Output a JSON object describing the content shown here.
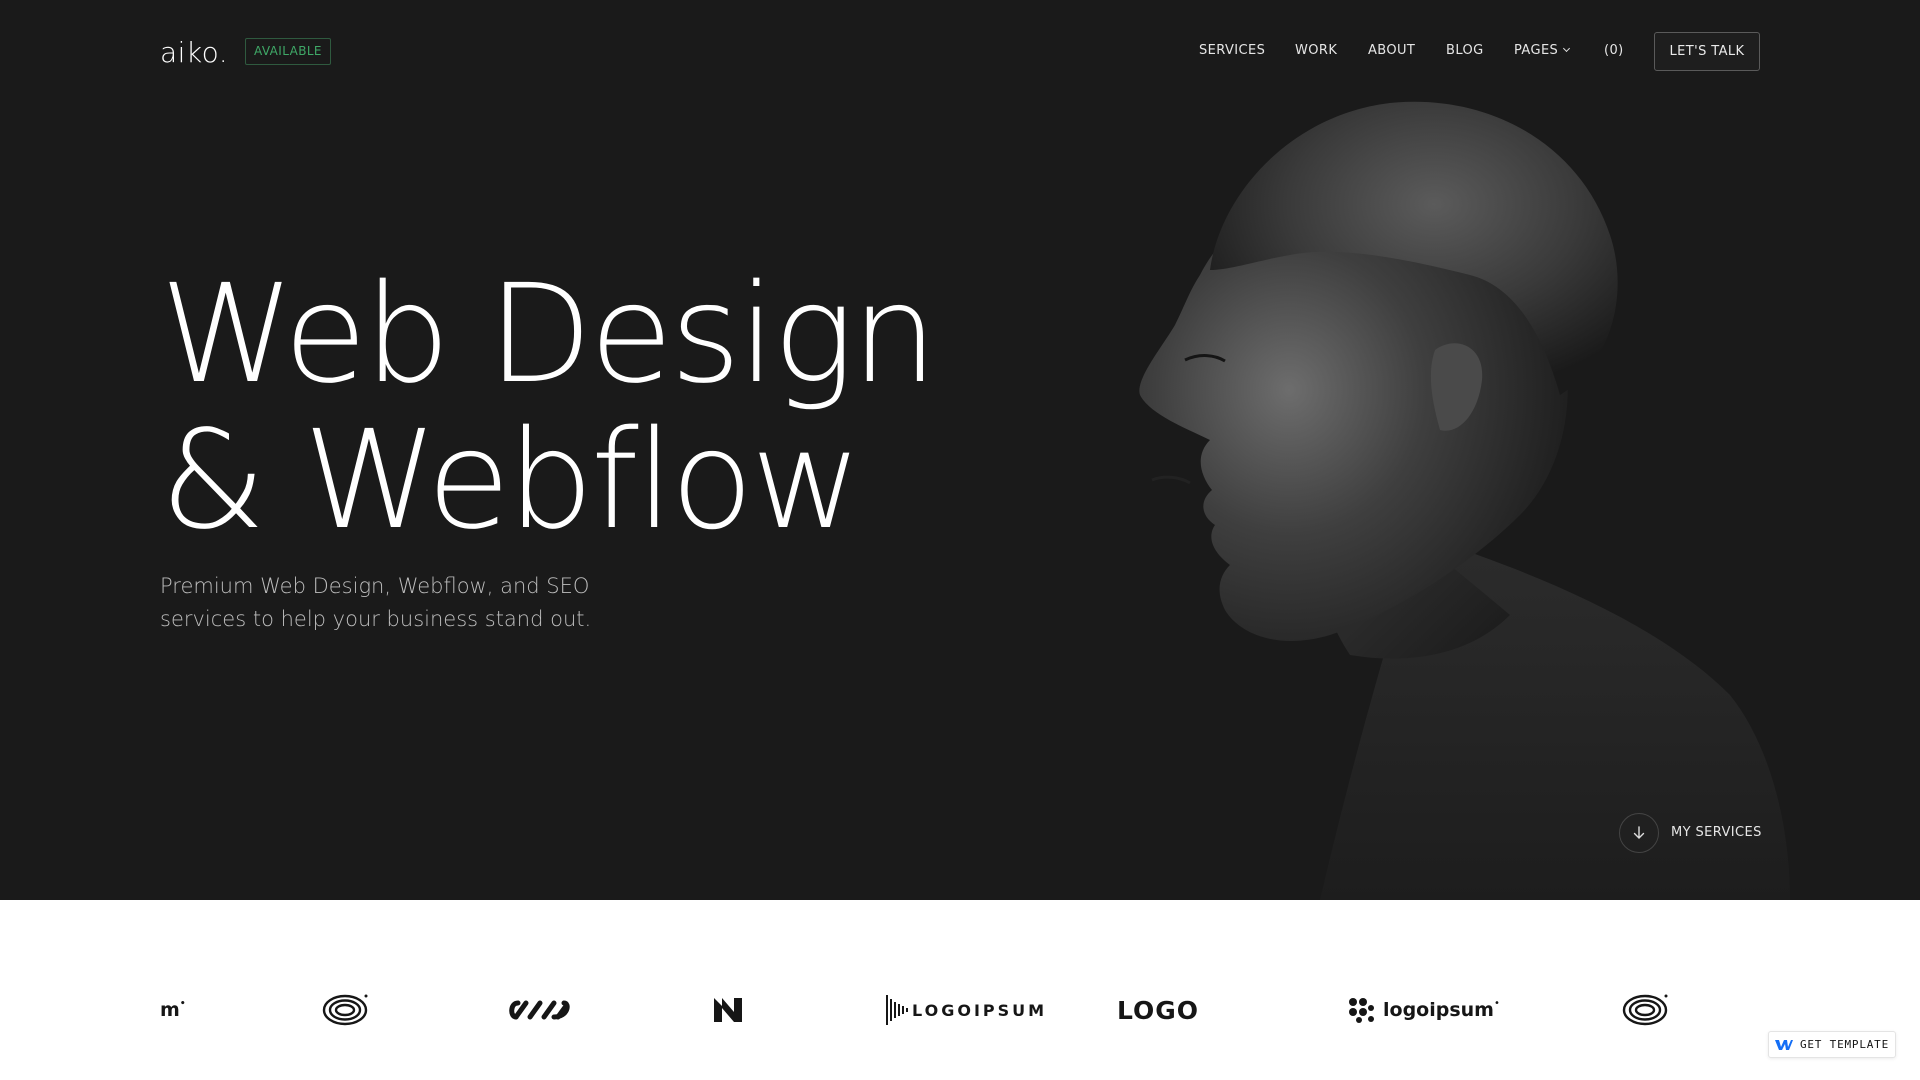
{
  "brand": {
    "name": "aiko.",
    "status_badge": "AVAILABLE"
  },
  "nav": {
    "items": [
      "SERVICES",
      "WORK",
      "ABOUT",
      "BLOG",
      "PAGES",
      "(0)"
    ],
    "cta": "LET'S TALK"
  },
  "hero": {
    "headline_line1": "Web Design",
    "headline_line2": "& Webflow",
    "subtitle": "Premium Web Design, Webflow, and SEO services to help your business stand out.",
    "scroll_label": "MY SERVICES",
    "scroll_icon": "arrow-down-icon"
  },
  "client_logos": [
    {
      "name": "m-logo",
      "text": "m"
    },
    {
      "name": "ring-logo"
    },
    {
      "name": "infinity-logo"
    },
    {
      "name": "n-logo"
    },
    {
      "name": "logoipsum-bars-logo",
      "text": "LOGOIPSUM"
    },
    {
      "name": "logo-wordmark",
      "text": "LOGO"
    },
    {
      "name": "logoipsum-logo",
      "text": "logoipsum"
    },
    {
      "name": "ring-logo-2"
    }
  ],
  "template_button": {
    "label": "GET TEMPLATE",
    "icon": "webflow-icon"
  },
  "colors": {
    "background": "#1a1a1a",
    "badge_green": "#3fa867",
    "strip": "#ffffff",
    "webflow_blue": "#146ef5"
  }
}
